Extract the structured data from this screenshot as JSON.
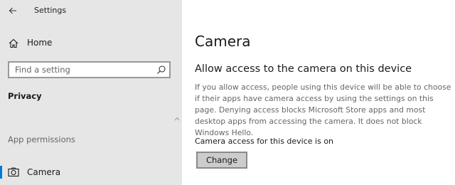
{
  "titlebar": {
    "back_icon": "back-arrow-icon",
    "app_title": "Settings"
  },
  "sidebar": {
    "home": {
      "icon": "home-icon",
      "label": "Home"
    },
    "search": {
      "placeholder": "Find a setting",
      "value": "",
      "icon": "search-icon"
    },
    "section_title": "Privacy",
    "group_label": "App permissions",
    "items": [
      {
        "icon": "camera-icon",
        "label": "Camera",
        "selected": true
      }
    ]
  },
  "main": {
    "page_title": "Camera",
    "section_heading": "Allow access to the camera on this device",
    "description": "If you allow access, people using this device will be able to choose if their apps have camera access by using the settings on this page. Denying access blocks Microsoft Store apps and most desktop apps from accessing the camera. It does not block Windows Hello.",
    "status": "Camera access for this device is on",
    "change_button_label": "Change"
  },
  "colors": {
    "sidebar_bg": "#e6e6e6",
    "main_bg": "#ffffff",
    "accent": "#0078d7",
    "button_bg": "#cccccc",
    "button_border": "#8a8a8a",
    "muted_text": "#666666"
  }
}
